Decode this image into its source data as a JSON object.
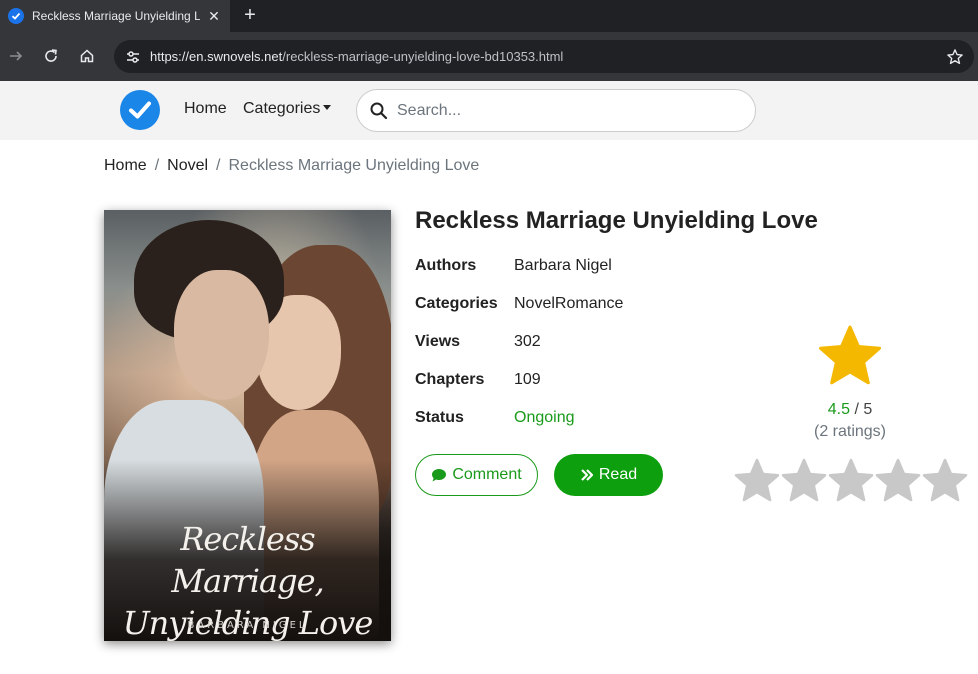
{
  "browser": {
    "tab_title": "Reckless Marriage Unyielding Lo",
    "url_host": "https://en.swnovels.net",
    "url_path": "/reckless-marriage-unyielding-love-bd10353.html",
    "new_tab_label": "+",
    "close_label": "✕"
  },
  "navbar": {
    "home_label": "Home",
    "categories_label": "Categories",
    "search_placeholder": "Search..."
  },
  "breadcrumb": [
    "Home",
    "Novel",
    "Reckless Marriage Unyielding Love"
  ],
  "cover": {
    "title_line1": "Reckless Marriage,",
    "title_line2": "Unyielding Love",
    "author": "BARBARA NIGEL"
  },
  "book": {
    "title": "Reckless Marriage Unyielding Love",
    "details": [
      {
        "label": "Authors",
        "value": "Barbara Nigel"
      },
      {
        "label": "Categories",
        "value": "NovelRomance"
      },
      {
        "label": "Views",
        "value": "302"
      },
      {
        "label": "Chapters",
        "value": "109"
      },
      {
        "label": "Status",
        "value": "Ongoing"
      }
    ],
    "comment_label": "Comment",
    "read_label": "Read"
  },
  "rating": {
    "score": "4.5",
    "out_of": "/ 5",
    "count": "(2 ratings)",
    "rate_star_count": 5
  },
  "colors": {
    "accent_green": "#1a9a1a",
    "read_button": "#0d9f0d",
    "star_gold": "#f5b800",
    "star_gray": "#c8c8c8",
    "logo_blue": "#1a86e8"
  },
  "icons": {
    "tab": "checkmark-favicon",
    "back": "arrow-right-icon",
    "reload": "reload-icon",
    "home": "home-icon",
    "site_info": "tune-icon",
    "bookmark": "star-outline-icon",
    "search": "search-icon",
    "comment": "speech-bubble-icon",
    "read": "double-chevron-right-icon"
  }
}
